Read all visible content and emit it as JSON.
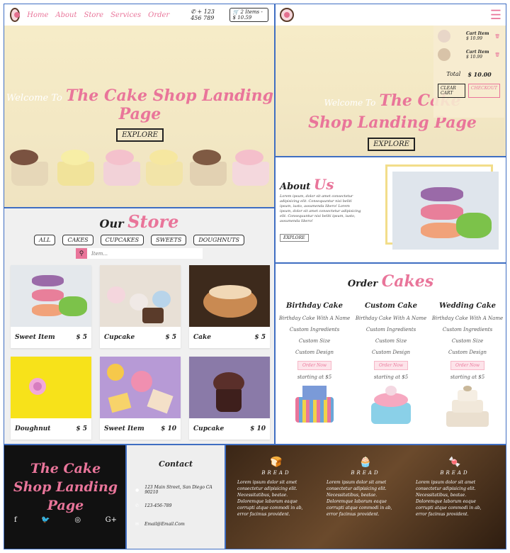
{
  "nav": {
    "links": [
      "Home",
      "About",
      "Store",
      "Services",
      "Order"
    ],
    "phone": "+ 123 456 789",
    "cart_summary": "2 Items - $ 10.59"
  },
  "hero": {
    "welcome": "Welcome To",
    "title": "The Cake Shop Landing Page",
    "button": "EXPLORE"
  },
  "cart": {
    "items": [
      {
        "name": "Cart Item",
        "price": "$ 10.99"
      },
      {
        "name": "Cart Item",
        "price": "$ 10.99"
      }
    ],
    "total_label": "Total",
    "total_value": "$ 10.00",
    "clear_label": "CLEAR CART",
    "checkout_label": "CHECKOUT"
  },
  "store": {
    "heading_a": "Our",
    "heading_b": "Store",
    "filters": [
      "ALL",
      "CAKES",
      "CUPCAKES",
      "SWEETS",
      "DOUGHNUTS"
    ],
    "search_placeholder": "Item...",
    "items": [
      {
        "name": "Sweet Item",
        "price": "$ 5"
      },
      {
        "name": "Cupcake",
        "price": "$ 5"
      },
      {
        "name": "Cake",
        "price": "$ 5"
      },
      {
        "name": "Doughnut",
        "price": "$ 5"
      },
      {
        "name": "Sweet Item",
        "price": "$ 10"
      },
      {
        "name": "Cupcake",
        "price": "$ 10"
      }
    ]
  },
  "about": {
    "heading_a": "About",
    "heading_b": "Us",
    "text": "Lorem ipsum, dolor sit amet consectetur adipisicing elit. Consequuntur nisi beliti ipsum, iusto, assumenda libero! Lorem ipsum, dolor sit amet consectetur adipisicing elit. Consequuntur nisi beliti ipsum, iusto, assumenda libero!",
    "button": "EXPLORE"
  },
  "order": {
    "heading_a": "Order",
    "heading_b": "Cakes",
    "columns": [
      {
        "title": "Birthday Cake",
        "lines": [
          "Birthday Cake With A Name",
          "Custom Ingredients",
          "Custom Size",
          "Custom Design"
        ],
        "button": "Order Now",
        "starting": "starting at $5"
      },
      {
        "title": "Custom Cake",
        "lines": [
          "Birthday Cake With A Name",
          "Custom Ingredients",
          "Custom Size",
          "Custom Design"
        ],
        "button": "Order Now",
        "starting": "starting at $5"
      },
      {
        "title": "Wedding Cake",
        "lines": [
          "Birthday Cake With A Name",
          "Custom Ingredients",
          "Custom Size",
          "Custom Design"
        ],
        "button": "Order Now",
        "starting": "starting at $5"
      }
    ]
  },
  "footer": {
    "brand": "The Cake Shop Landing Page",
    "social_icons": [
      "facebook-icon",
      "twitter-icon",
      "instagram-icon",
      "google-plus-icon"
    ],
    "contact_heading": "Contact",
    "address": "123 Main Street, San Diego CA 90210",
    "phone": "123-456-789",
    "email": "Email@Email.Com",
    "bread_boxes": [
      {
        "title": "BREAD",
        "text": "Lorem ipsum dolor sit amet consectetur adipisicing elit. Necessitatibus, beatae. Doloremque laborum eaque corrupti atque commodi in ab, error facimus provident."
      },
      {
        "title": "BREAD",
        "text": "Lorem ipsum dolor sit amet consectetur adipisicing elit. Necessitatibus, beatae. Doloremque laborum eaque corrupti atque commodi in ab, error facimus provident."
      },
      {
        "title": "BREAD",
        "text": "Lorem ipsum dolor sit amet consectetur adipisicing elit. Necessitatibus, beatae. Doloremque laborum eaque corrupti atque commodi in ab, error facimus provident."
      }
    ]
  },
  "colors": {
    "accent": "#e9759a",
    "dark": "#111111"
  }
}
